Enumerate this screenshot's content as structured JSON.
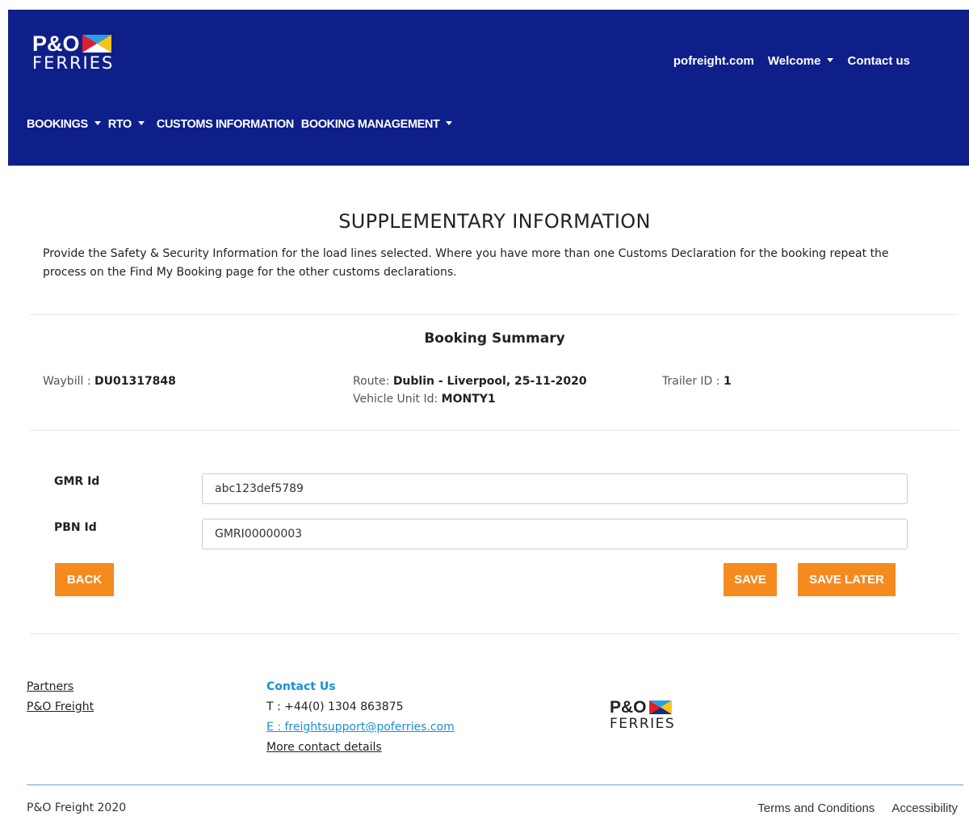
{
  "brand": {
    "logo_top": "P&O",
    "logo_bottom": "FERRIES"
  },
  "topnav": {
    "site_link": "pofreight.com",
    "welcome": "Welcome",
    "contact": "Contact us"
  },
  "mainnav": {
    "bookings": "BOOKINGS",
    "rto": "RTO",
    "customs": "CUSTOMS INFORMATION",
    "booking_mgmt": "BOOKING MANAGEMENT"
  },
  "page": {
    "title": "SUPPLEMENTARY INFORMATION",
    "intro": "Provide the Safety & Security Information for the load lines selected. Where you have more than one Customs Declaration for the booking repeat the process on the Find My Booking page for the other customs declarations."
  },
  "summary": {
    "title": "Booking Summary",
    "waybill_label": "Waybill : ",
    "waybill_value": "DU01317848",
    "route_label": "Route: ",
    "route_value": "Dublin - Liverpool, 25-11-2020",
    "vehicle_label": "Vehicle Unit Id: ",
    "vehicle_value": "MONTY1",
    "trailer_label": "Trailer ID : ",
    "trailer_value": "1"
  },
  "form": {
    "gmr_label": "GMR Id",
    "gmr_value": "abc123def5789",
    "pbn_label": "PBN Id",
    "pbn_value": "GMRI00000003"
  },
  "buttons": {
    "back": "BACK",
    "save": "SAVE",
    "save_later": "SAVE LATER"
  },
  "footer": {
    "partners": "Partners",
    "po_freight": "P&O Freight",
    "contact_head": "Contact Us",
    "phone": "T : +44(0) 1304 863875",
    "email": "E : freightsupport@poferries.com",
    "more_contact": "More contact details",
    "copyright": "P&O Freight 2020",
    "terms": "Terms and Conditions",
    "accessibility": "Accessibility"
  },
  "colors": {
    "header_bg": "#0f1f8a",
    "accent": "#f58a1f",
    "link": "#1a8fd6"
  }
}
